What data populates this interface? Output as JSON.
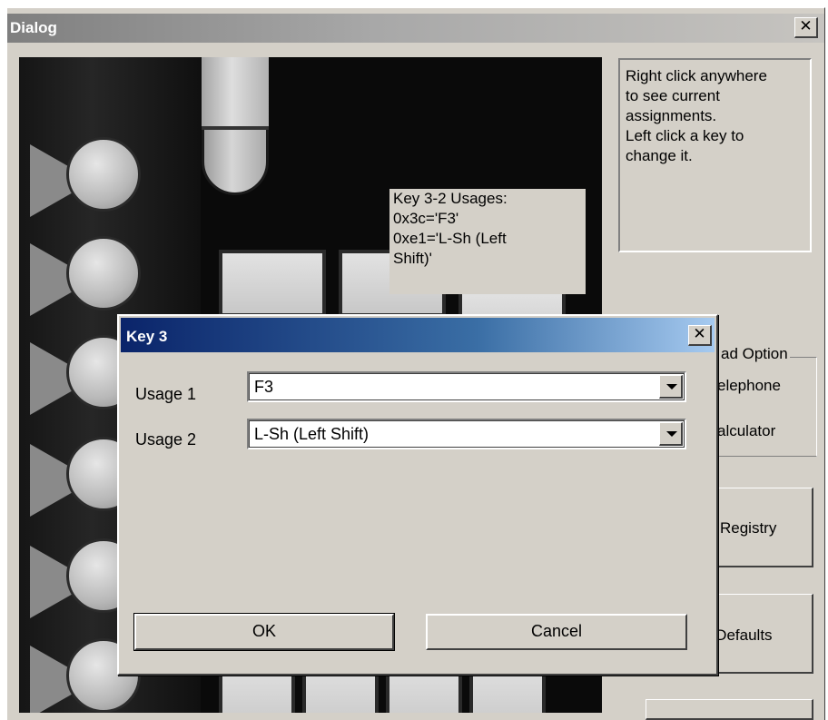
{
  "outer_window": {
    "title": "Dialog",
    "close_glyph": "✕"
  },
  "tooltip": {
    "lines": [
      "Key 3-2 Usages:",
      "0x3c='F3'",
      "0xe1='L-Sh (Left",
      "Shift)'"
    ]
  },
  "info_box": {
    "lines": [
      "Right click anywhere",
      "to see current",
      "assignments.",
      "Left click a key to",
      "change it."
    ]
  },
  "option_group": {
    "label": "ad Option",
    "items": [
      "elephone",
      "alculator"
    ]
  },
  "right_buttons": {
    "registry": "Registry",
    "defaults": "e Defaults"
  },
  "modal": {
    "title": "Key 3",
    "close_glyph": "✕",
    "usage1_label": "Usage 1",
    "usage1_value": "F3",
    "usage2_label": "Usage 2",
    "usage2_value": "L-Sh (Left Shift)",
    "ok_label": "OK",
    "cancel_label": "Cancel"
  },
  "colors": {
    "dialog_bg": "#d4d0c8",
    "active_title_start": "#0a246a",
    "active_title_end": "#a6caf0",
    "inactive_title_start": "#7f7f7f"
  }
}
